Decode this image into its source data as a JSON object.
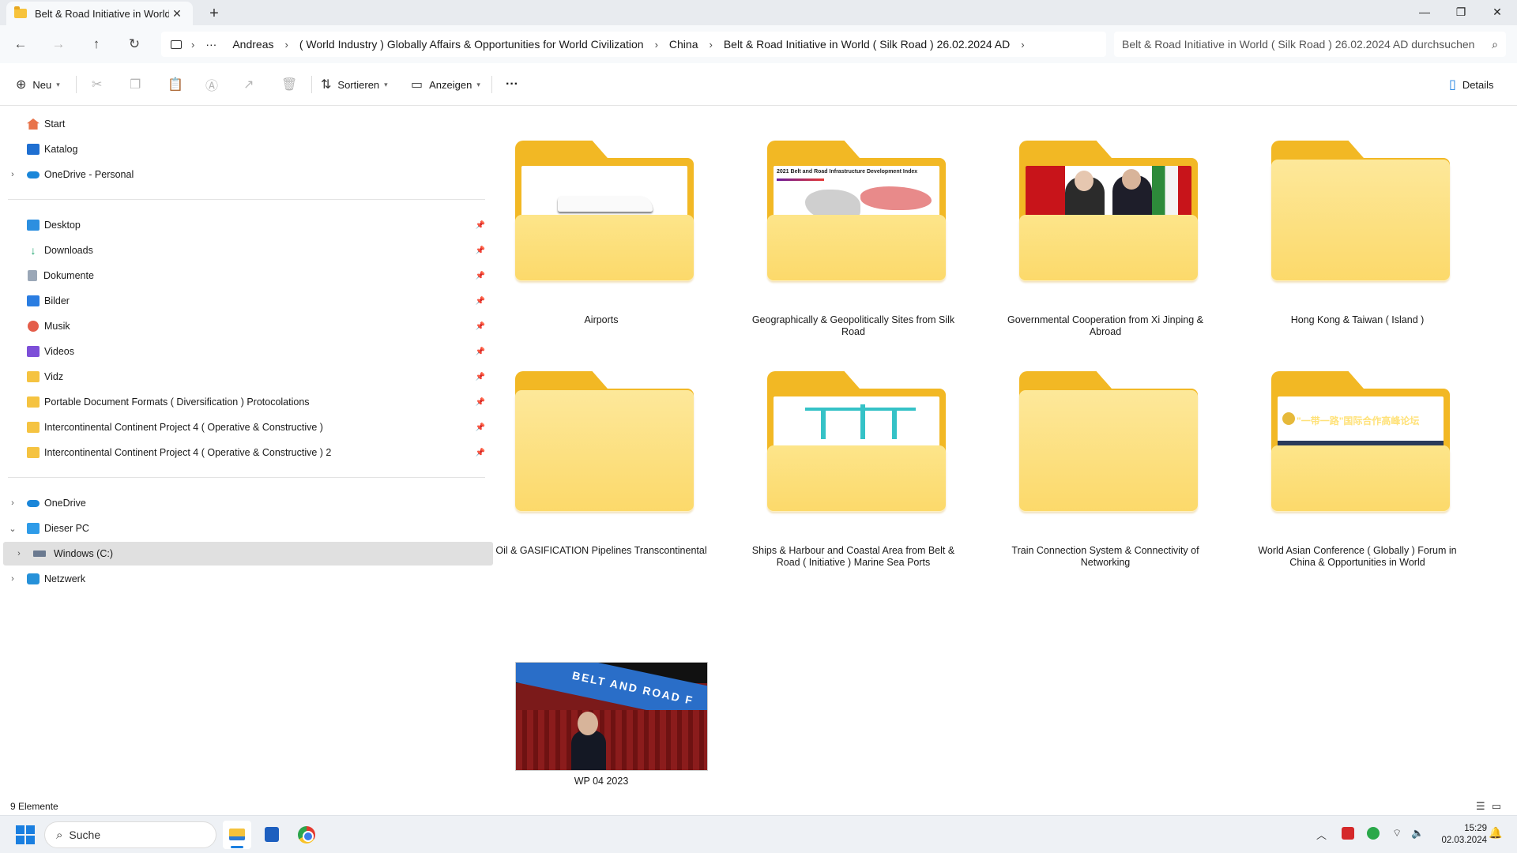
{
  "window": {
    "tab_title": "Belt & Road Initiative in World",
    "tab_close": "✕",
    "tab_add": "+",
    "minimize": "—",
    "maximize": "❐",
    "close": "✕"
  },
  "nav": {
    "back": "←",
    "forward": "→",
    "up": "↑",
    "refresh": "↻",
    "more": "···",
    "breadcrumb": [
      "Andreas",
      "( World Industry ) Globally Affairs & Opportunities for World Civilization",
      "China",
      "Belt & Road Initiative in World ( Silk Road ) 26.02.2024 AD"
    ],
    "sep": "›",
    "search_placeholder": "Belt & Road Initiative in World ( Silk Road ) 26.02.2024 AD durchsuchen"
  },
  "toolbar": {
    "new_label": "Neu",
    "sort_label": "Sortieren",
    "view_label": "Anzeigen",
    "more": "···",
    "details_label": "Details"
  },
  "sidebar": {
    "top": [
      {
        "label": "Start"
      },
      {
        "label": "Katalog"
      },
      {
        "label": "OneDrive - Personal"
      }
    ],
    "quick": [
      {
        "label": "Desktop"
      },
      {
        "label": "Downloads"
      },
      {
        "label": "Dokumente"
      },
      {
        "label": "Bilder"
      },
      {
        "label": "Musik"
      },
      {
        "label": "Videos"
      },
      {
        "label": "Vidz"
      },
      {
        "label": "Portable Document Formats ( Diversification ) Protocolations"
      },
      {
        "label": "Intercontinental Continent Project 4 ( Operative & Constructive )"
      },
      {
        "label": "Intercontinental Continent Project 4 ( Operative & Constructive ) 2"
      }
    ],
    "bottom": [
      {
        "label": "OneDrive"
      },
      {
        "label": "Dieser PC"
      },
      {
        "label": "Windows (C:)"
      },
      {
        "label": "Netzwerk"
      }
    ]
  },
  "items": [
    {
      "label": "Airports"
    },
    {
      "label": "Geographically & Geopolitically Sites from Silk Road"
    },
    {
      "label": "Governmental Cooperation from Xi Jinping & Abroad"
    },
    {
      "label": "Hong Kong & Taiwan ( Island )"
    },
    {
      "label": "Oil & GASIFICATION Pipelines Transcontinental"
    },
    {
      "label": "Ships & Harbour and Coastal Area  from Belt & Road ( Initiative ) Marine Sea Ports"
    },
    {
      "label": "Train Connection System & Connectivity of Networking"
    },
    {
      "label": "World Asian Conference ( Globally ) Forum in China & Opportunities in World"
    },
    {
      "label": "WP 04 2023"
    }
  ],
  "thumbs": {
    "map_title": "2021 Belt and Road Infrastructure Development Index",
    "forum_title": "\"一带一路\"国际合作高峰论坛",
    "photo_banner": "BELT AND ROAD F"
  },
  "status": {
    "count": "9 Elemente"
  },
  "taskbar": {
    "search_label": "Suche",
    "time": "15:29",
    "date": "02.03.2024"
  },
  "colors": {
    "folder_back": "#f2b824",
    "folder_front": "#fcd96a",
    "accent": "#1a7fe0"
  }
}
